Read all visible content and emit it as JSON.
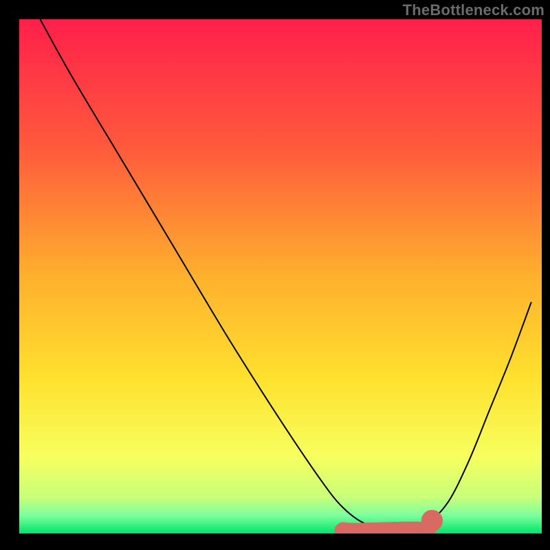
{
  "watermark": "TheBottleneck.com",
  "chart_data": {
    "type": "line",
    "title": "",
    "xlabel": "",
    "ylabel": "",
    "xlim": [
      0,
      100
    ],
    "ylim": [
      0,
      100
    ],
    "grid": false,
    "legend": false,
    "axes_visible": false,
    "background_gradient": {
      "stops": [
        {
          "pos": 0.0,
          "color": "#ff1f4b"
        },
        {
          "pos": 0.25,
          "color": "#ff5a3c"
        },
        {
          "pos": 0.5,
          "color": "#ffb02e"
        },
        {
          "pos": 0.7,
          "color": "#ffe12e"
        },
        {
          "pos": 0.85,
          "color": "#f7ff5e"
        },
        {
          "pos": 0.93,
          "color": "#c8ff7a"
        },
        {
          "pos": 0.965,
          "color": "#7dff9e"
        },
        {
          "pos": 1.0,
          "color": "#00e56a"
        }
      ]
    },
    "series": [
      {
        "name": "bottleneck-curve",
        "stroke": "#000000",
        "stroke_width": 2,
        "x": [
          4,
          10,
          20,
          30,
          40,
          50,
          58,
          62,
          66,
          70,
          74,
          78,
          82,
          86,
          90,
          94,
          98
        ],
        "y": [
          100,
          89,
          72,
          55,
          38,
          22,
          10,
          5,
          2,
          1,
          1,
          2,
          6,
          14,
          24,
          34,
          45
        ]
      }
    ],
    "highlight_band": {
      "name": "optimal-zone",
      "color": "#d96a63",
      "x_start": 62,
      "x_end": 78,
      "y": 0.5,
      "thickness": 3.4,
      "end_dot_x": 79,
      "end_dot_y": 2.5,
      "end_dot_r": 2.1
    },
    "frame": {
      "inner_left_pct": 3.5,
      "inner_right_pct": 98.5,
      "inner_top_pct": 3.5,
      "inner_bottom_pct": 97.0
    }
  }
}
